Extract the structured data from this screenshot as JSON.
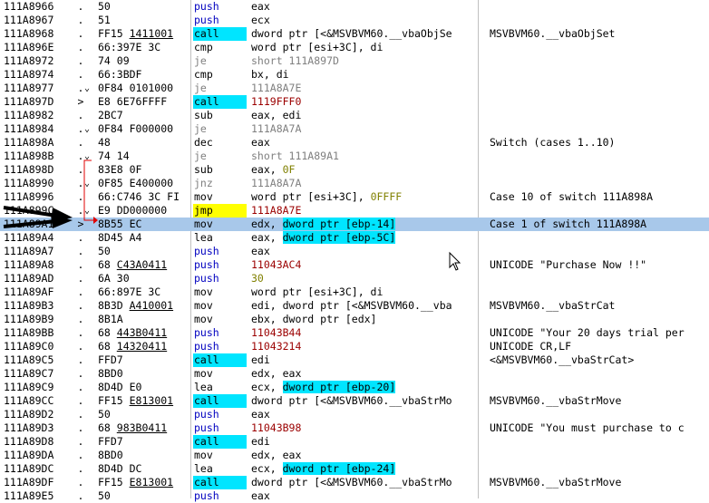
{
  "rows": [
    {
      "addr": "111A8966",
      "mark": ".",
      "hex": "50",
      "mnem": "push",
      "ops": [
        {
          "t": "eax"
        }
      ],
      "comment": ""
    },
    {
      "addr": "111A8967",
      "mark": ".",
      "hex": "51",
      "mnem": "push",
      "ops": [
        {
          "t": "ecx"
        }
      ],
      "comment": ""
    },
    {
      "addr": "111A8968",
      "mark": ".",
      "hex": "FF15 1411001",
      "hexu": "1411001",
      "mnem": "call",
      "ops": [
        {
          "t": "dword ptr [<&MSVBVM60.__vbaObjSe"
        }
      ],
      "comment": "MSVBVM60.__vbaObjSet"
    },
    {
      "addr": "111A896E",
      "mark": ".",
      "hex": "66:397E 3C",
      "mnem": "cmp",
      "ops": [
        {
          "t": "word ptr [esi+3C], di"
        }
      ],
      "comment": ""
    },
    {
      "addr": "111A8972",
      "mark": ".",
      "hex": "74 09",
      "mnem": "je",
      "ops": [
        {
          "t": "short 111A897D"
        }
      ],
      "comment": ""
    },
    {
      "addr": "111A8974",
      "mark": ".",
      "hex": "66:3BDF",
      "mnem": "cmp",
      "ops": [
        {
          "t": "bx, di"
        }
      ],
      "comment": ""
    },
    {
      "addr": "111A8977",
      "mark": ".",
      "arrow": "⌄",
      "hex": "0F84 0101000",
      "mnem": "je",
      "ops": [
        {
          "t": "111A8A7E"
        }
      ],
      "comment": ""
    },
    {
      "addr": "111A897D",
      "mark": ">",
      "hex": "E8 6E76FFFF",
      "mnem": "call",
      "ops": [
        {
          "t": "1119FFF0"
        }
      ],
      "comment": ""
    },
    {
      "addr": "111A8982",
      "mark": ".",
      "hex": "2BC7",
      "mnem": "sub",
      "ops": [
        {
          "t": "eax, edi"
        }
      ],
      "comment": ""
    },
    {
      "addr": "111A8984",
      "mark": ".",
      "arrow": "⌄",
      "hex": "0F84 F000000",
      "mnem": "je",
      "ops": [
        {
          "t": "111A8A7A"
        }
      ],
      "comment": ""
    },
    {
      "addr": "111A898A",
      "mark": ".",
      "hex": "48",
      "mnem": "dec",
      "ops": [
        {
          "t": "eax"
        }
      ],
      "comment": "Switch (cases 1..10)"
    },
    {
      "addr": "111A898B",
      "mark": ".",
      "arrow": "⌄",
      "hex": "74 14",
      "mnem": "je",
      "ops": [
        {
          "t": "short 111A89A1"
        }
      ],
      "comment": ""
    },
    {
      "addr": "111A898D",
      "mark": ".",
      "hex": "83E8 0F",
      "mnem": "sub",
      "ops": [
        {
          "t": "eax, "
        },
        {
          "t": "0F",
          "c": "num"
        }
      ],
      "comment": ""
    },
    {
      "addr": "111A8990",
      "mark": ".",
      "arrow": "⌄",
      "hex": "0F85 E400000",
      "mnem": "jnz",
      "ops": [
        {
          "t": "111A8A7A"
        }
      ],
      "comment": ""
    },
    {
      "addr": "111A8996",
      "mark": ".",
      "hex": "66:C746 3C FI",
      "mnem": "mov",
      "ops": [
        {
          "t": "word ptr [esi+3C], "
        },
        {
          "t": "0FFFF",
          "c": "num"
        }
      ],
      "comment": "Case 10 of switch 111A898A"
    },
    {
      "addr": "111A899C",
      "mark": ".",
      "arrow": "⌄",
      "hex": "E9 DD000000",
      "mnem": "jmp",
      "ops": [
        {
          "t": "111A8A7E"
        }
      ],
      "comment": ""
    },
    {
      "addr": "111A89A1",
      "mark": ">",
      "hex": "8B55 EC",
      "mnem": "mov",
      "ops": [
        {
          "t": "edx, "
        },
        {
          "t": "dword ptr [ebp-14]",
          "c": "hl"
        }
      ],
      "comment": "Case 1 of switch 111A898A"
    },
    {
      "addr": "111A89A4",
      "mark": ".",
      "hex": "8D45 A4",
      "mnem": "lea",
      "ops": [
        {
          "t": "eax, "
        },
        {
          "t": "dword ptr [ebp-5C]",
          "c": "hl"
        }
      ],
      "comment": ""
    },
    {
      "addr": "111A89A7",
      "mark": ".",
      "hex": "50",
      "mnem": "push",
      "ops": [
        {
          "t": "eax"
        }
      ],
      "comment": ""
    },
    {
      "addr": "111A89A8",
      "mark": ".",
      "hex": "68 C43A0411",
      "hexu": "C43A0411",
      "mnem": "push",
      "ops": [
        {
          "t": "11043AC4"
        }
      ],
      "comment": "UNICODE \"Purchase Now !!\""
    },
    {
      "addr": "111A89AD",
      "mark": ".",
      "hex": "6A 30",
      "mnem": "push",
      "ops": [
        {
          "t": "30"
        }
      ],
      "comment": ""
    },
    {
      "addr": "111A89AF",
      "mark": ".",
      "hex": "66:897E 3C",
      "mnem": "mov",
      "ops": [
        {
          "t": "word ptr [esi+3C], di"
        }
      ],
      "comment": ""
    },
    {
      "addr": "111A89B3",
      "mark": ".",
      "hex": "8B3D A410001",
      "hexu": "A410001",
      "mnem": "mov",
      "ops": [
        {
          "t": "edi, dword ptr [<&MSVBVM60.__vba"
        }
      ],
      "comment": "MSVBVM60.__vbaStrCat"
    },
    {
      "addr": "111A89B9",
      "mark": ".",
      "hex": "8B1A",
      "mnem": "mov",
      "ops": [
        {
          "t": "ebx, dword ptr [edx]"
        }
      ],
      "comment": ""
    },
    {
      "addr": "111A89BB",
      "mark": ".",
      "hex": "68 443B0411",
      "hexu": "443B0411",
      "mnem": "push",
      "ops": [
        {
          "t": "11043B44"
        }
      ],
      "comment": "UNICODE \"Your 20 days trial per"
    },
    {
      "addr": "111A89C0",
      "mark": ".",
      "hex": "68 14320411",
      "hexu": "14320411",
      "mnem": "push",
      "ops": [
        {
          "t": "11043214"
        }
      ],
      "comment": "UNICODE CR,LF"
    },
    {
      "addr": "111A89C5",
      "mark": ".",
      "hex": "FFD7",
      "mnem": "call",
      "ops": [
        {
          "t": "edi"
        }
      ],
      "comment": "<&MSVBVM60.__vbaStrCat>"
    },
    {
      "addr": "111A89C7",
      "mark": ".",
      "hex": "8BD0",
      "mnem": "mov",
      "ops": [
        {
          "t": "edx, eax"
        }
      ],
      "comment": ""
    },
    {
      "addr": "111A89C9",
      "mark": ".",
      "hex": "8D4D E0",
      "mnem": "lea",
      "ops": [
        {
          "t": "ecx, "
        },
        {
          "t": "dword ptr [ebp-20]",
          "c": "hl"
        }
      ],
      "comment": ""
    },
    {
      "addr": "111A89CC",
      "mark": ".",
      "hex": "FF15 E813001",
      "hexu": "E813001",
      "mnem": "call",
      "ops": [
        {
          "t": "dword ptr [<&MSVBVM60.__vbaStrMo"
        }
      ],
      "comment": "MSVBVM60.__vbaStrMove"
    },
    {
      "addr": "111A89D2",
      "mark": ".",
      "hex": "50",
      "mnem": "push",
      "ops": [
        {
          "t": "eax"
        }
      ],
      "comment": ""
    },
    {
      "addr": "111A89D3",
      "mark": ".",
      "hex": "68 983B0411",
      "hexu": "983B0411",
      "mnem": "push",
      "ops": [
        {
          "t": "11043B98"
        }
      ],
      "comment": "UNICODE \"You must purchase to c"
    },
    {
      "addr": "111A89D8",
      "mark": ".",
      "hex": "FFD7",
      "mnem": "call",
      "ops": [
        {
          "t": "edi"
        }
      ],
      "comment": ""
    },
    {
      "addr": "111A89DA",
      "mark": ".",
      "hex": "8BD0",
      "mnem": "mov",
      "ops": [
        {
          "t": "edx, eax"
        }
      ],
      "comment": ""
    },
    {
      "addr": "111A89DC",
      "mark": ".",
      "hex": "8D4D DC",
      "mnem": "lea",
      "ops": [
        {
          "t": "ecx, "
        },
        {
          "t": "dword ptr [ebp-24]",
          "c": "hl"
        }
      ],
      "comment": ""
    },
    {
      "addr": "111A89DF",
      "mark": ".",
      "hex": "FF15 E813001",
      "hexu": "E813001",
      "mnem": "call",
      "ops": [
        {
          "t": "dword ptr [<&MSVBVM60.__vbaStrMo"
        }
      ],
      "comment": "MSVBVM60.__vbaStrMove"
    },
    {
      "addr": "111A89E5",
      "mark": ".",
      "hex": "50",
      "mnem": "push",
      "ops": [
        {
          "t": "eax"
        }
      ],
      "comment": ""
    }
  ],
  "selected_row": 16,
  "colors": {
    "selection": "#a8c8ea",
    "call_bg": "#00e5ff",
    "jmp_bg": "#ffff00",
    "jcc_text": "#808080",
    "push_text": "#0000c0",
    "target_red": "#9b0000",
    "immediate": "#808000",
    "jump_line": "#e00000"
  },
  "icons": {
    "pointer_arrow": "black-arrow-icon",
    "cursor": "mouse-pointer-icon"
  }
}
